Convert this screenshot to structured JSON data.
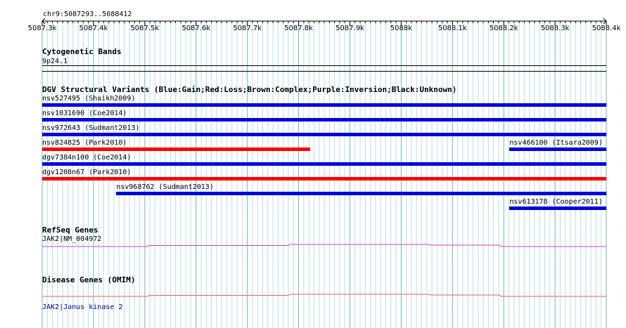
{
  "ruler": {
    "range_label": "chr9:5087293..5088412",
    "ticks": [
      "5087.3k",
      "5087.4k",
      "5087.5k",
      "5087.6k",
      "5087.7k",
      "5087.8k",
      "5087.9k",
      "5088k",
      "5088.1k",
      "5088.2k",
      "5088.3k",
      "5088.4k"
    ],
    "start": 5087293,
    "end": 5088412
  },
  "tracks": {
    "cytoband": {
      "title": "Cytogenetic Bands",
      "band": "9p24.1"
    },
    "dgv": {
      "title": "DGV Structural Variants (Blue:Gain;Red:Loss;Brown:Complex;Purple:Inversion;Black:Unknown)",
      "colors": {
        "gain": "#0000dd",
        "loss": "#ff0000"
      },
      "variants": [
        {
          "label": "nsv527495 (Shaikh2009)",
          "type": "gain",
          "start": 5087293,
          "end": 5088412
        },
        {
          "label": "nsv1031690 (Coe2014)",
          "type": "gain",
          "start": 5087293,
          "end": 5088412
        },
        {
          "label": "nsv972643 (Sudmant2013)",
          "type": "gain",
          "start": 5087293,
          "end": 5088412
        },
        {
          "label": "nsv824825 (Park2010)",
          "type": "loss",
          "start": 5087293,
          "end": 5087824
        },
        {
          "label": "nsv466100 (Itsara2009)",
          "type": "gain",
          "start": 5088220,
          "end": 5088412
        },
        {
          "label": "dgv7384n100 (Coe2014)",
          "type": "gain",
          "start": 5087293,
          "end": 5088412
        },
        {
          "label": "dgv1208n67 (Park2010)",
          "type": "loss",
          "start": 5087293,
          "end": 5088412
        },
        {
          "label": "nsv968762 (Sudmant2013)",
          "type": "gain",
          "start": 5087440,
          "end": 5088412
        },
        {
          "label": "nsv613178 (Cooper2011)",
          "type": "gain",
          "start": 5088220,
          "end": 5088412
        }
      ]
    },
    "refseq": {
      "title": "RefSeq Genes",
      "gene": "JAK2|NM_004972",
      "color": "#cc44cc"
    },
    "omim": {
      "title": "Disease Genes (OMIM)",
      "gene": "JAK2|Janus kinase 2",
      "color": "#dd6655",
      "gene_color": "#000099"
    }
  }
}
